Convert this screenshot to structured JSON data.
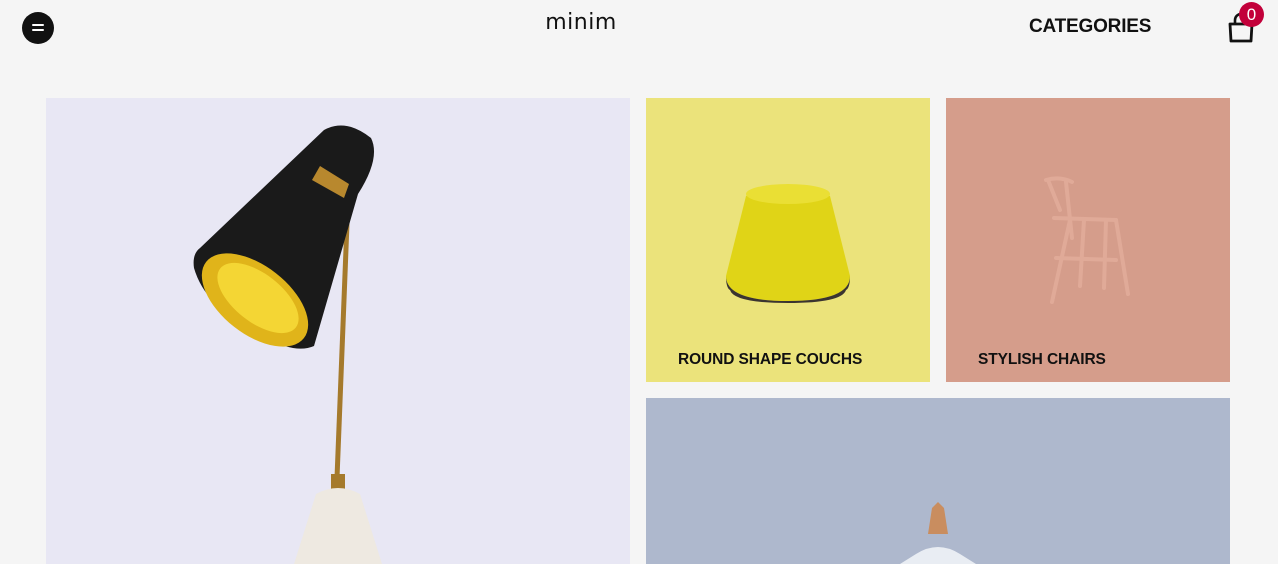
{
  "header": {
    "logo": "minim",
    "nav_categories": "CATEGORIES",
    "cart_count": "0"
  },
  "tiles": [
    {
      "label": ""
    },
    {
      "label": "ROUND SHAPE COUCHS"
    },
    {
      "label": "STYLISH CHAIRS"
    },
    {
      "label": ""
    }
  ],
  "colors": {
    "background": "#f5f5f5",
    "lamp_tile": "#e8e7f4",
    "couch_tile": "#ebe37b",
    "chair_tile": "#d59d8b",
    "pendant_tile": "#aeb8cd",
    "badge": "#c2003a"
  },
  "icons": [
    "menu-icon",
    "shopping-bag-icon"
  ]
}
